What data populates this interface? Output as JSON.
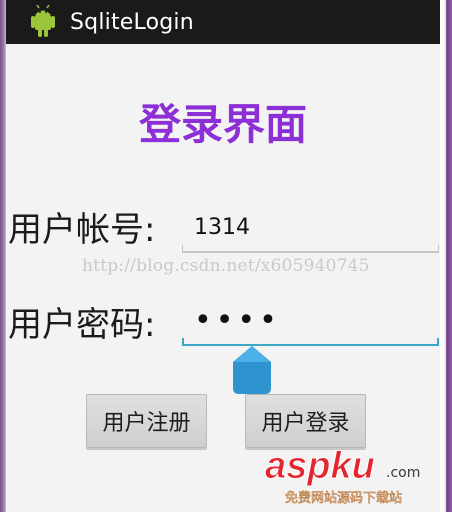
{
  "app": {
    "title": "SqliteLogin",
    "icon": "android-icon"
  },
  "page": {
    "title": "登录界面"
  },
  "form": {
    "username_label": "用户帐号:",
    "username_value": "1314",
    "password_label": "用户密码:",
    "password_value": "••••"
  },
  "buttons": {
    "register": "用户注册",
    "login": "用户登录"
  },
  "watermark": {
    "url": "http://blog.csdn.net/x605940745",
    "brand_main": "aspku",
    "brand_sub": ".com",
    "brand_caption": "免费网站源码下载站"
  },
  "colors": {
    "titlebar_bg": "#1a1a1a",
    "title_text": "#ffffff",
    "page_title": "#8d2fd6",
    "focus_blue": "#3ba6c6",
    "brand_red": "#e3262f",
    "brand_text": "#ffffff"
  }
}
